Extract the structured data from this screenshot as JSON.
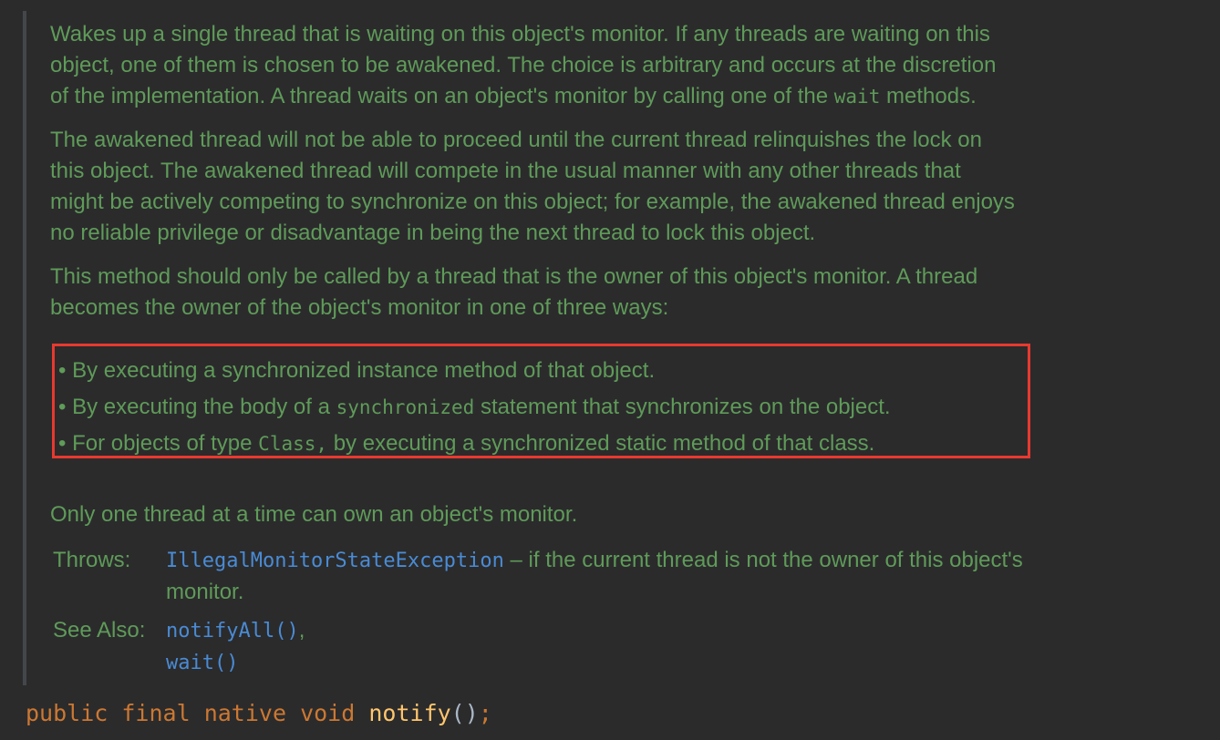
{
  "doc": {
    "para1": [
      "Wakes up a single thread that is waiting on this object's monitor. If any threads are waiting on this",
      "object, one of them is chosen to be awakened. The choice is arbitrary and occurs at the discretion",
      "of the implementation. A thread waits on an object's monitor by calling one of the ",
      "wait",
      " methods."
    ],
    "para2": [
      "The awakened thread will not be able to proceed until the current thread relinquishes the lock on",
      "this object. The awakened thread will compete in the usual manner with any other threads that",
      "might be actively competing to synchronize on this object; for example, the awakened thread enjoys",
      "no reliable privilege or disadvantage in being the next thread to lock this object."
    ],
    "para3": [
      "This method should only be called by a thread that is the owner of this object's monitor. A thread",
      "becomes the owner of the object's monitor in one of three ways:"
    ],
    "bullets": {
      "b1": "• By executing a synchronized instance method of that object.",
      "b2_pre": "• By executing the body of a ",
      "b2_code": "synchronized",
      "b2_post": " statement that synchronizes on the object.",
      "b3_pre": "• For objects of type ",
      "b3_code": "Class,",
      "b3_post": " by executing a synchronized static method of that class."
    },
    "para4": "Only one thread at a time can own an object's monitor.",
    "throws": {
      "label": "Throws:",
      "link": "IllegalMonitorStateException",
      "text1": " – if the current thread is not the owner of this object's",
      "text2": "monitor."
    },
    "see_also": {
      "label": "See Also:",
      "link1": "notifyAll()",
      "sep": ",",
      "link2": "wait()"
    }
  },
  "code": {
    "kw1": "public",
    "kw2": "final",
    "kw3": "native",
    "kw4": "void",
    "method": "notify",
    "parens": "()",
    "semi": ";"
  },
  "colors": {
    "doc_text": "#5f9b59",
    "link": "#4a8bd4",
    "keyword": "#cc7832",
    "method": "#ffc66d",
    "highlight_border": "#e8392f",
    "background": "#2b2b2c"
  }
}
